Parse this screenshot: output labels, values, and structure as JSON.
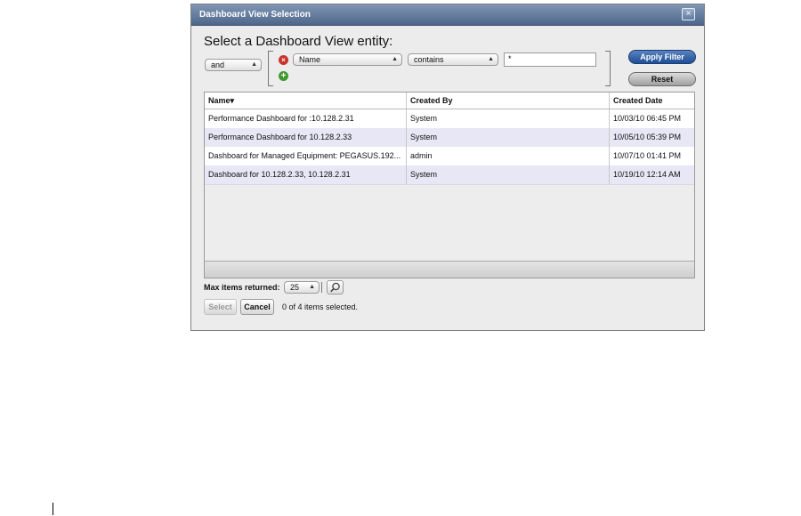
{
  "dialog": {
    "title": "Dashboard View Selection",
    "close_glyph": "×",
    "heading": "Select a Dashboard View entity:"
  },
  "filter": {
    "conjunction": "and",
    "field": "Name",
    "operator": "contains",
    "value": "*",
    "remove_glyph": "×",
    "add_glyph": "+",
    "apply_label": "Apply Filter",
    "reset_label": "Reset"
  },
  "table": {
    "columns": [
      "Name",
      "Created By",
      "Created Date"
    ],
    "sort_indicator": "▾",
    "rows": [
      [
        "Performance Dashboard for :10.128.2.31",
        "System",
        "10/03/10 06:45 PM"
      ],
      [
        "Performance Dashboard for 10.128.2.33",
        "System",
        "10/05/10 05:39 PM"
      ],
      [
        "Dashboard for Managed Equipment: PEGASUS.192...",
        "admin",
        "10/07/10 01:41 PM"
      ],
      [
        "Dashboard for 10.128.2.33, 10.128.2.31",
        "System",
        "10/19/10 12:14 AM"
      ]
    ]
  },
  "footer": {
    "max_items_label": "Max items returned:",
    "max_items_value": "25",
    "select_label": "Select",
    "cancel_label": "Cancel",
    "status": "0 of 4 items selected."
  },
  "icons": {
    "close": "close-icon",
    "remove": "remove-filter-icon",
    "add": "add-filter-icon",
    "search": "magnifier-icon"
  }
}
